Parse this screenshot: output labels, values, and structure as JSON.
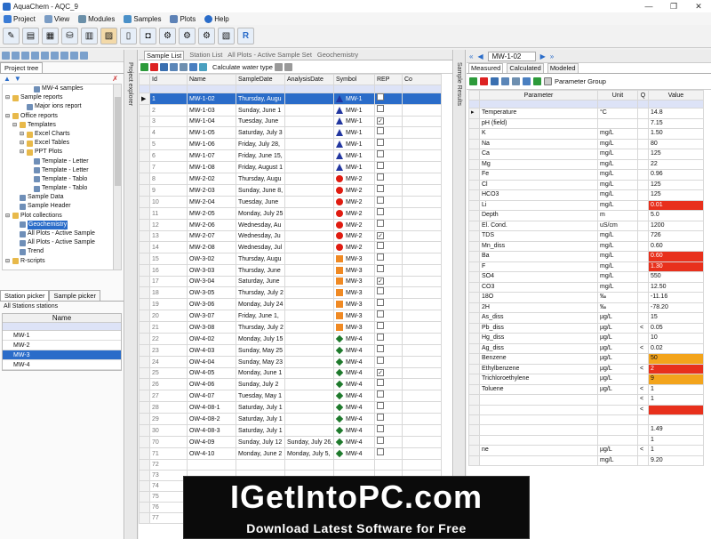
{
  "window": {
    "title": "AquaChem - AQC_9"
  },
  "menu": [
    "Project",
    "View",
    "Modules",
    "Samples",
    "Plots",
    "Help"
  ],
  "left": {
    "tab": "Project tree",
    "tree": [
      {
        "label": "MW-4 samples",
        "indent": 3,
        "icon": "doc",
        "sel": false
      },
      {
        "label": "Sample reports",
        "indent": 0,
        "icon": "folder",
        "sel": false
      },
      {
        "label": "Major ions report",
        "indent": 2,
        "icon": "doc",
        "sel": false
      },
      {
        "label": "Office reports",
        "indent": 0,
        "icon": "folder",
        "sel": false
      },
      {
        "label": "Templates",
        "indent": 1,
        "icon": "folder",
        "sel": false
      },
      {
        "label": "Excel Charts",
        "indent": 2,
        "icon": "folder",
        "sel": false
      },
      {
        "label": "Excel Tables",
        "indent": 2,
        "icon": "folder",
        "sel": false
      },
      {
        "label": "PPT Plots",
        "indent": 2,
        "icon": "folder",
        "sel": false
      },
      {
        "label": "Template - Letter",
        "indent": 3,
        "icon": "doc",
        "sel": false
      },
      {
        "label": "Template - Letter",
        "indent": 3,
        "icon": "doc",
        "sel": false
      },
      {
        "label": "Template - Tablo",
        "indent": 3,
        "icon": "doc",
        "sel": false
      },
      {
        "label": "Template - Tablo",
        "indent": 3,
        "icon": "doc",
        "sel": false
      },
      {
        "label": "Sample Data",
        "indent": 1,
        "icon": "doc",
        "sel": false
      },
      {
        "label": "Sample Header",
        "indent": 1,
        "icon": "doc",
        "sel": false
      },
      {
        "label": "Plot collections",
        "indent": 0,
        "icon": "folder",
        "sel": false
      },
      {
        "label": "Geochemistry",
        "indent": 1,
        "icon": "doc",
        "sel": true
      },
      {
        "label": "All Plots - Active Sample",
        "indent": 1,
        "icon": "doc",
        "sel": false
      },
      {
        "label": "All Plots - Active Sample",
        "indent": 1,
        "icon": "doc",
        "sel": false
      },
      {
        "label": "Trend",
        "indent": 1,
        "icon": "doc",
        "sel": false
      },
      {
        "label": "R-scripts",
        "indent": 0,
        "icon": "folder",
        "sel": false
      }
    ],
    "picker_tabs": [
      "Station picker",
      "Sample picker"
    ],
    "picker_caption": "All Stations stations",
    "picker_header": "Name",
    "stations": [
      "MW-1",
      "MW-2",
      "MW-3",
      "MW-4"
    ],
    "selected_station": "MW-3"
  },
  "project_explorer_label": "Project explorer",
  "sample_results_label": "Sample Results",
  "center": {
    "tabs": [
      "Sample List",
      "Station List",
      "All Plots - Active Sample Set",
      "Geochemistry"
    ],
    "toolbar_text": "Calculate water type",
    "headers": [
      "Id",
      "Name",
      "SampleDate",
      "AnalysisDate",
      "Symbol",
      "REP",
      "Co"
    ],
    "rows": [
      {
        "id": "1",
        "name": "MW-1-02",
        "date": "Thursday, Augu",
        "adate": "",
        "sym": "tri",
        "sname": "MW-1",
        "rep": "",
        "sel": true
      },
      {
        "id": "2",
        "name": "MW-1-03",
        "date": "Sunday, June 1",
        "adate": "",
        "sym": "tri",
        "sname": "MW-1",
        "rep": "",
        "sel": false
      },
      {
        "id": "3",
        "name": "MW-1-04",
        "date": "Tuesday, June",
        "adate": "",
        "sym": "tri",
        "sname": "MW-1",
        "rep": "✓",
        "sel": false
      },
      {
        "id": "4",
        "name": "MW-1-05",
        "date": "Saturday, July 3",
        "adate": "",
        "sym": "tri",
        "sname": "MW-1",
        "rep": "",
        "sel": false
      },
      {
        "id": "5",
        "name": "MW-1-06",
        "date": "Friday, July 28,",
        "adate": "",
        "sym": "tri",
        "sname": "MW-1",
        "rep": "",
        "sel": false
      },
      {
        "id": "6",
        "name": "MW-1-07",
        "date": "Friday, June 15,",
        "adate": "",
        "sym": "tri",
        "sname": "MW-1",
        "rep": "",
        "sel": false
      },
      {
        "id": "7",
        "name": "MW-1-08",
        "date": "Friday, August 1",
        "adate": "",
        "sym": "tri",
        "sname": "MW-1",
        "rep": "",
        "sel": false
      },
      {
        "id": "8",
        "name": "MW-2-02",
        "date": "Thursday, Augu",
        "adate": "",
        "sym": "circ",
        "sname": "MW-2",
        "rep": "",
        "sel": false
      },
      {
        "id": "9",
        "name": "MW-2-03",
        "date": "Sunday, June 8,",
        "adate": "",
        "sym": "circ",
        "sname": "MW-2",
        "rep": "",
        "sel": false
      },
      {
        "id": "10",
        "name": "MW-2-04",
        "date": "Tuesday, June",
        "adate": "",
        "sym": "circ",
        "sname": "MW-2",
        "rep": "",
        "sel": false
      },
      {
        "id": "11",
        "name": "MW-2-05",
        "date": "Monday, July 25",
        "adate": "",
        "sym": "circ",
        "sname": "MW-2",
        "rep": "",
        "sel": false
      },
      {
        "id": "12",
        "name": "MW-2-06",
        "date": "Wednesday, Au",
        "adate": "",
        "sym": "circ",
        "sname": "MW-2",
        "rep": "",
        "sel": false
      },
      {
        "id": "13",
        "name": "MW-2-07",
        "date": "Wednesday, Ju",
        "adate": "",
        "sym": "circ",
        "sname": "MW-2",
        "rep": "✓",
        "sel": false
      },
      {
        "id": "14",
        "name": "MW-2-08",
        "date": "Wednesday, Jul",
        "adate": "",
        "sym": "circ",
        "sname": "MW-2",
        "rep": "",
        "sel": false
      },
      {
        "id": "15",
        "name": "OW-3-02",
        "date": "Thursday, Augu",
        "adate": "",
        "sym": "sq",
        "sname": "MW-3",
        "rep": "",
        "sel": false
      },
      {
        "id": "16",
        "name": "OW-3-03",
        "date": "Thursday, June",
        "adate": "",
        "sym": "sq",
        "sname": "MW-3",
        "rep": "",
        "sel": false
      },
      {
        "id": "17",
        "name": "OW-3-04",
        "date": "Saturday, June",
        "adate": "",
        "sym": "sq",
        "sname": "MW-3",
        "rep": "✓",
        "sel": false
      },
      {
        "id": "18",
        "name": "OW-3-05",
        "date": "Thursday, July 2",
        "adate": "",
        "sym": "sq",
        "sname": "MW-3",
        "rep": "",
        "sel": false
      },
      {
        "id": "19",
        "name": "OW-3-06",
        "date": "Monday, July 24",
        "adate": "",
        "sym": "sq",
        "sname": "MW-3",
        "rep": "",
        "sel": false
      },
      {
        "id": "20",
        "name": "OW-3-07",
        "date": "Friday, June 1,",
        "adate": "",
        "sym": "sq",
        "sname": "MW-3",
        "rep": "",
        "sel": false
      },
      {
        "id": "21",
        "name": "OW-3-08",
        "date": "Thursday, July 2",
        "adate": "",
        "sym": "sq",
        "sname": "MW-3",
        "rep": "",
        "sel": false
      },
      {
        "id": "22",
        "name": "OW-4-02",
        "date": "Monday, July 15",
        "adate": "",
        "sym": "dia",
        "sname": "MW-4",
        "rep": "",
        "sel": false
      },
      {
        "id": "23",
        "name": "OW-4-03",
        "date": "Sunday, May 25",
        "adate": "",
        "sym": "dia",
        "sname": "MW-4",
        "rep": "",
        "sel": false
      },
      {
        "id": "24",
        "name": "OW-4-04",
        "date": "Sunday, May 23",
        "adate": "",
        "sym": "dia",
        "sname": "MW-4",
        "rep": "",
        "sel": false
      },
      {
        "id": "25",
        "name": "OW-4-05",
        "date": "Monday, June 1",
        "adate": "",
        "sym": "dia",
        "sname": "MW-4",
        "rep": "✓",
        "sel": false
      },
      {
        "id": "26",
        "name": "OW-4-06",
        "date": "Sunday, July 2",
        "adate": "",
        "sym": "dia",
        "sname": "MW-4",
        "rep": "",
        "sel": false
      },
      {
        "id": "27",
        "name": "OW-4-07",
        "date": "Tuesday, May 1",
        "adate": "",
        "sym": "dia",
        "sname": "MW-4",
        "rep": "",
        "sel": false
      },
      {
        "id": "28",
        "name": "OW-4-08-1",
        "date": "Saturday, July 1",
        "adate": "",
        "sym": "dia",
        "sname": "MW-4",
        "rep": "",
        "sel": false
      },
      {
        "id": "29",
        "name": "OW-4-08-2",
        "date": "Saturday, July 1",
        "adate": "",
        "sym": "dia",
        "sname": "MW-4",
        "rep": "",
        "sel": false
      },
      {
        "id": "30",
        "name": "OW-4-08-3",
        "date": "Saturday, July 1",
        "adate": "",
        "sym": "dia",
        "sname": "MW-4",
        "rep": "",
        "sel": false
      },
      {
        "id": "70",
        "name": "OW-4-09",
        "date": "Sunday, July 12",
        "adate": "Sunday, July 26,",
        "sym": "dia",
        "sname": "MW-4",
        "rep": "",
        "sel": false
      },
      {
        "id": "71",
        "name": "OW-4-10",
        "date": "Monday, June 2",
        "adate": "Monday, July 5,",
        "sym": "dia",
        "sname": "MW-4",
        "rep": "",
        "sel": false
      },
      {
        "id": "72",
        "name": "",
        "date": "",
        "adate": "",
        "sym": "",
        "sname": "",
        "rep": "",
        "sel": false
      },
      {
        "id": "73",
        "name": "",
        "date": "",
        "adate": "",
        "sym": "",
        "sname": "",
        "rep": "",
        "sel": false
      },
      {
        "id": "74",
        "name": "",
        "date": "",
        "adate": "",
        "sym": "",
        "sname": "",
        "rep": "",
        "sel": false
      },
      {
        "id": "75",
        "name": "",
        "date": "",
        "adate": "",
        "sym": "",
        "sname": "",
        "rep": "",
        "sel": false
      },
      {
        "id": "76",
        "name": "",
        "date": "",
        "adate": "",
        "sym": "",
        "sname": "",
        "rep": "",
        "sel": false
      },
      {
        "id": "77",
        "name": "",
        "date": "",
        "adate": "",
        "sym": "",
        "sname": "",
        "rep": "",
        "sel": false
      }
    ]
  },
  "right": {
    "sample": "MW-1-02",
    "tabs": [
      "Measured",
      "Calculated",
      "Modeled"
    ],
    "param_group": "Parameter Group",
    "headers": [
      "Parameter",
      "Unit",
      "Q",
      "Value"
    ],
    "params": [
      {
        "p": "Temperature",
        "u": "°C",
        "q": "",
        "v": "14.8",
        "hl": ""
      },
      {
        "p": "pH (field)",
        "u": "",
        "q": "",
        "v": "7.15",
        "hl": ""
      },
      {
        "p": "K",
        "u": "mg/L",
        "q": "",
        "v": "1.50",
        "hl": ""
      },
      {
        "p": "Na",
        "u": "mg/L",
        "q": "",
        "v": "80",
        "hl": ""
      },
      {
        "p": "Ca",
        "u": "mg/L",
        "q": "",
        "v": "125",
        "hl": ""
      },
      {
        "p": "Mg",
        "u": "mg/L",
        "q": "",
        "v": "22",
        "hl": ""
      },
      {
        "p": "Fe",
        "u": "mg/L",
        "q": "",
        "v": "0.96",
        "hl": ""
      },
      {
        "p": "Cl",
        "u": "mg/L",
        "q": "",
        "v": "125",
        "hl": ""
      },
      {
        "p": "HCO3",
        "u": "mg/L",
        "q": "",
        "v": "125",
        "hl": ""
      },
      {
        "p": "Li",
        "u": "mg/L",
        "q": "",
        "v": "0.01",
        "hl": "red"
      },
      {
        "p": "Depth",
        "u": "m",
        "q": "",
        "v": "5.0",
        "hl": ""
      },
      {
        "p": "El. Cond.",
        "u": "uS/cm",
        "q": "",
        "v": "1200",
        "hl": ""
      },
      {
        "p": "TDS",
        "u": "mg/L",
        "q": "",
        "v": "726",
        "hl": ""
      },
      {
        "p": "Mn_diss",
        "u": "mg/L",
        "q": "",
        "v": "0.60",
        "hl": ""
      },
      {
        "p": "Ba",
        "u": "mg/L",
        "q": "",
        "v": "0.60",
        "hl": "red"
      },
      {
        "p": "F",
        "u": "mg/L",
        "q": "",
        "v": "1.30",
        "hl": "red"
      },
      {
        "p": "SO4",
        "u": "mg/L",
        "q": "",
        "v": "550",
        "hl": ""
      },
      {
        "p": "CO3",
        "u": "mg/L",
        "q": "",
        "v": "12.50",
        "hl": ""
      },
      {
        "p": "18O",
        "u": "‰",
        "q": "",
        "v": "-11.16",
        "hl": ""
      },
      {
        "p": "2H",
        "u": "‰",
        "q": "",
        "v": "-78.20",
        "hl": ""
      },
      {
        "p": "As_diss",
        "u": "µg/L",
        "q": "",
        "v": "15",
        "hl": ""
      },
      {
        "p": "Pb_diss",
        "u": "µg/L",
        "q": "<",
        "v": "0.05",
        "hl": ""
      },
      {
        "p": "Hg_diss",
        "u": "µg/L",
        "q": "",
        "v": "10",
        "hl": ""
      },
      {
        "p": "Ag_diss",
        "u": "µg/L",
        "q": "<",
        "v": "0.02",
        "hl": ""
      },
      {
        "p": "Benzene",
        "u": "µg/L",
        "q": "",
        "v": "50",
        "hl": "orange"
      },
      {
        "p": "Ethylbenzene",
        "u": "µg/L",
        "q": "<",
        "v": "2",
        "hl": "red"
      },
      {
        "p": "Trichloroethylene",
        "u": "µg/L",
        "q": "",
        "v": "9",
        "hl": "orange"
      },
      {
        "p": "Toluene",
        "u": "µg/L",
        "q": "<",
        "v": "1",
        "hl": ""
      },
      {
        "p": "",
        "u": "",
        "q": "<",
        "v": "1",
        "hl": ""
      },
      {
        "p": "",
        "u": "",
        "q": "<",
        "v": "",
        "hl": "red"
      },
      {
        "p": "",
        "u": "",
        "q": "",
        "v": "",
        "hl": ""
      },
      {
        "p": "",
        "u": "",
        "q": "",
        "v": "1.49",
        "hl": ""
      },
      {
        "p": "",
        "u": "",
        "q": "",
        "v": "1",
        "hl": ""
      },
      {
        "p": "ne",
        "u": "µg/L",
        "q": "<",
        "v": "1",
        "hl": ""
      },
      {
        "p": "",
        "u": "mg/L",
        "q": "",
        "v": "9.20",
        "hl": ""
      }
    ]
  },
  "watermark": {
    "line1": "IGetIntoPC.com",
    "line2": "Download Latest Software for Free"
  }
}
